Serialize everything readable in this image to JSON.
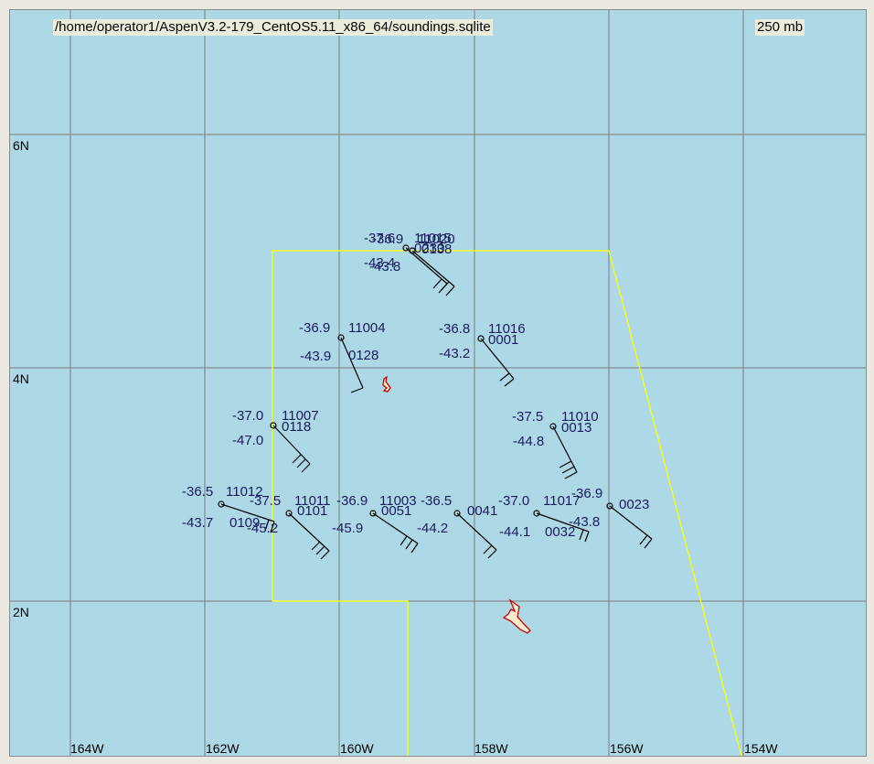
{
  "header": {
    "file_path": "/home/operator1/AspenV3.2-179_CentOS5.11_x86_64/soundings.sqlite",
    "pressure_level": "250 mb"
  },
  "colors": {
    "ocean": "#add8e6",
    "grid": "#7a7a7a",
    "boundary": "#ffff00",
    "station_text": "#1a1a5e",
    "island_fill": "#f5ecd0",
    "island_outline": "#cc0000"
  },
  "grid": {
    "lon_labels": [
      "164W",
      "162W",
      "160W",
      "158W",
      "156W",
      "154W"
    ],
    "lat_labels": [
      "6N",
      "4N",
      "2N"
    ]
  },
  "stations": [
    {
      "id": "11015",
      "temp": "-37.6",
      "dewpoint": "-43.4",
      "time": "0230"
    },
    {
      "id": "11020",
      "temp": "-36.9",
      "dewpoint": "-43.8",
      "time": "0138"
    },
    {
      "id": "11004",
      "temp": "-36.9",
      "dewpoint": "-43.9",
      "time": "0128"
    },
    {
      "id": "11016",
      "temp": "-36.8",
      "dewpoint": "-43.2",
      "time": "0001"
    },
    {
      "id": "11007",
      "temp": "-37.0",
      "dewpoint": "-47.0",
      "time": "0118"
    },
    {
      "id": "11010",
      "temp": "-37.5",
      "dewpoint": "-44.8",
      "time": "0013"
    },
    {
      "id": "11012",
      "temp": "-36.5",
      "dewpoint": "-43.7",
      "time": "0109"
    },
    {
      "id": "11011",
      "temp": "-37.5",
      "dewpoint": "-45.2",
      "time": "0101"
    },
    {
      "id": "11003",
      "temp": "-36.9",
      "dewpoint": "-45.9",
      "time": "0051"
    },
    {
      "id": "",
      "temp": "-36.5",
      "dewpoint": "-44.2",
      "time": "0041"
    },
    {
      "id": "11017",
      "temp": "-37.0",
      "dewpoint": "-44.1",
      "time": "0032"
    },
    {
      "id": "",
      "temp": "-36.9",
      "dewpoint": "-43.8",
      "time": "0023"
    }
  ]
}
